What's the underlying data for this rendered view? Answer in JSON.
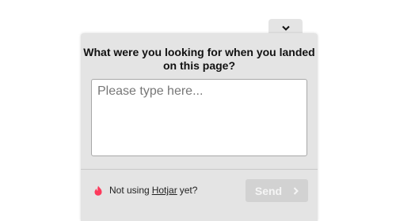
{
  "survey": {
    "question": "What were you looking for when you landed on this page?",
    "answer_placeholder": "Please type here...",
    "answer_value": ""
  },
  "footer": {
    "text_before": "Not using",
    "link_text": "Hotjar",
    "text_after": "yet?",
    "send_label": "Send"
  },
  "icons": {
    "collapse": "chevron-down-icon",
    "brand": "hotjar-flame-icon",
    "send": "chevron-right-icon"
  },
  "colors": {
    "panel": "#e4e4e4",
    "brand_flame": "#fd3a5c",
    "send_disabled": "#d2d2d2"
  }
}
